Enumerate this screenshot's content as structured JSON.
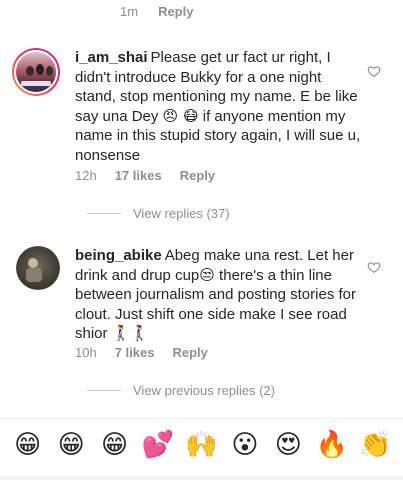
{
  "top_row": {
    "time": "1m",
    "reply": "Reply"
  },
  "comments": [
    {
      "username": "i_am_shai",
      "text_before": "Please get ur fact ur right, I didn't introduce Bukky for a one night stand, stop mentioning my name. E be like say una Dey ",
      "emojis_mid": "😠 😷",
      "text_after": " if anyone mention my name in this stupid story again, I will sue u, nonsense",
      "time": "12h",
      "likes": "17 likes",
      "reply": "Reply",
      "view_replies": "View replies (37)"
    },
    {
      "username": "being_abike",
      "text_before": "Abeg make una rest. Let her drink and drup cup",
      "emojis_mid": "😒",
      "text_after": " there's a thin line between journalism and posting stories for clout. Just shift one side make I see road shior ",
      "emojis_end": "🚶‍♀️🚶‍♀️",
      "time": "10h",
      "likes": "7 likes",
      "reply": "Reply",
      "view_replies": "View previous replies (2)"
    }
  ],
  "emoji_bar": [
    "😁",
    "😁",
    "😁",
    "💕",
    "🙌",
    "😮",
    "😍",
    "🔥",
    "👏"
  ],
  "colors": {
    "meta": "#8e8e8e",
    "text": "#262626",
    "ring_start": "#f9a33a",
    "ring_end": "#b62fa6"
  }
}
